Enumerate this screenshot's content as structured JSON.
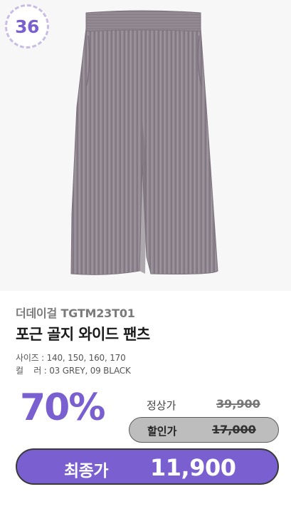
{
  "badge": {
    "number": "36"
  },
  "product": {
    "brand": "더데이걸 TGTM23T01",
    "name": "포근 골지 와이드 팬츠",
    "size_label": "사이즈 :",
    "sizes": "140, 150, 160, 170",
    "color_label": "컬    러 :",
    "colors": "03 GREY, 09 BLACK",
    "image": "corduroy-wide-pants-grey"
  },
  "pricing": {
    "discount": "70%",
    "regular_label": "정상가",
    "regular_price": "39,900",
    "sale_label": "할인가",
    "sale_price": "17,000",
    "final_label": "최종가",
    "final_price": "11,900"
  },
  "colors": {
    "accent": "#7a5fd0",
    "badge_border": "#c9bde6",
    "pants": "#918892"
  }
}
